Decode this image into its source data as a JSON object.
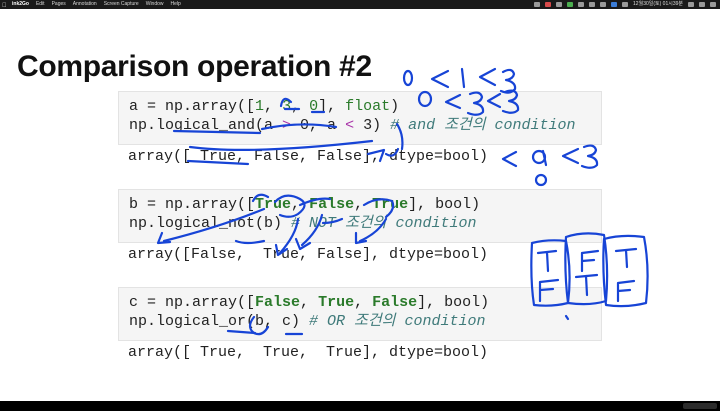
{
  "menubar": {
    "apple_icon": "apple-icon",
    "items": [
      "ink2Go",
      "Edit",
      "Pages",
      "Annotation",
      "Screen Capture",
      "Window",
      "Help"
    ],
    "clock": "12월30일(토) 01시39분"
  },
  "slide": {
    "title": "Comparison operation #2",
    "blocks": [
      {
        "code_line1": [
          "a = np.array([",
          "1",
          ", ",
          "3",
          ", ",
          "0",
          "], ",
          "float",
          ")"
        ],
        "code_line2": [
          "np.logical_and(a ",
          ">",
          " 0, a ",
          "<",
          " 3) ",
          "# and 조건의 condition"
        ],
        "output": "array([ True, False, False], dtype=bool)"
      },
      {
        "code_line1": [
          "b = np.array([",
          "True",
          ", ",
          "False",
          ", ",
          "True",
          "], bool)"
        ],
        "code_line2": [
          "np.logical_not(b) ",
          "# NOT 조건의 condition"
        ],
        "output": "array([False,  True, False], dtype=bool)"
      },
      {
        "code_line1": [
          "c = np.array([",
          "False",
          ", ",
          "True",
          ", ",
          "False",
          "], bool)"
        ],
        "code_line2": [
          "np.logical_or(b, c) ",
          "# OR 조건의 condition"
        ],
        "output": "array([ True,  True,  True], dtype=bool)"
      }
    ]
  },
  "colors": {
    "ink": "#1744d6",
    "string_green": "#2a7a2a",
    "operator_purple": "#a832a8",
    "comment_teal": "#3f7a7a",
    "code_bg": "#f5f5f5"
  }
}
